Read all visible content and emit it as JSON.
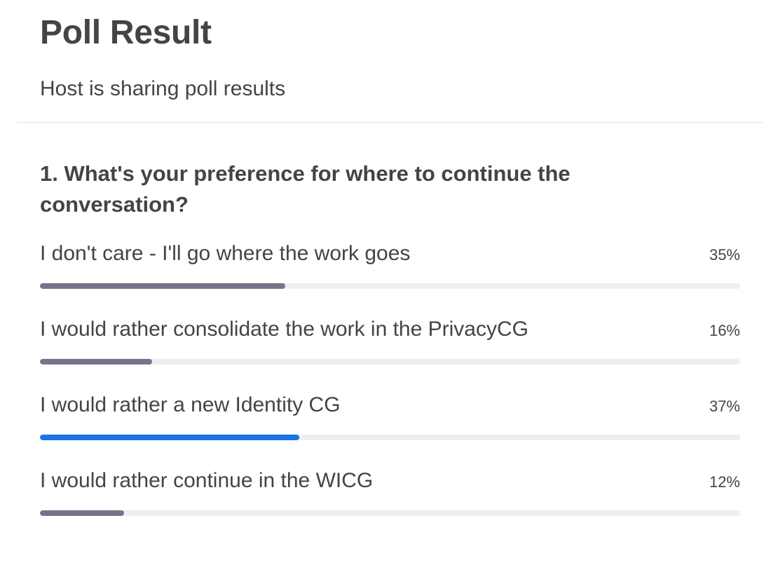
{
  "header": {
    "title": "Poll Result",
    "subtitle": "Host is sharing poll results"
  },
  "poll": {
    "question": "1. What's your preference for where to continue the conversation?",
    "options": [
      {
        "label": "I don't care - I'll go where the work goes",
        "percent_label": "35%",
        "value": 35,
        "leading": false
      },
      {
        "label": "I would rather consolidate the work in the PrivacyCG",
        "percent_label": "16%",
        "value": 16,
        "leading": false
      },
      {
        "label": "I would rather a new Identity CG",
        "percent_label": "37%",
        "value": 37,
        "leading": true
      },
      {
        "label": "I would rather continue in the WICG",
        "percent_label": "12%",
        "value": 12,
        "leading": false
      }
    ]
  },
  "colors": {
    "bar_default": "#74748a",
    "bar_leading": "#1a73e8",
    "bar_track": "#eeeef2",
    "text": "#444444"
  }
}
